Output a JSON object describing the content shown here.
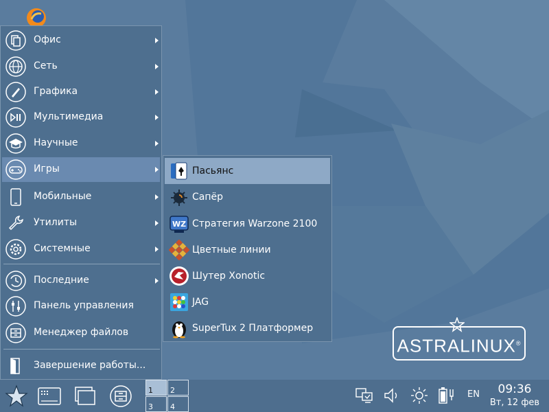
{
  "colors": {
    "desktop_bg": "#5a7c9e",
    "menu_bg": "#4e6f8f",
    "menu_highlight": "#6a8ab0",
    "submenu_highlight": "#8ea9c6",
    "taskbar_bg": "#4e6e8e",
    "text": "#ffffff"
  },
  "desktop": {
    "icon": "firefox-icon"
  },
  "main_menu": {
    "items": [
      {
        "label": "Офис",
        "icon": "office-icon",
        "submenu": true
      },
      {
        "label": "Сеть",
        "icon": "globe-icon",
        "submenu": true
      },
      {
        "label": "Графика",
        "icon": "brush-icon",
        "submenu": true
      },
      {
        "label": "Мультимедиа",
        "icon": "media-play-icon",
        "submenu": true
      },
      {
        "label": "Научные",
        "icon": "graduation-cap-icon",
        "submenu": true
      },
      {
        "label": "Игры",
        "icon": "gamepad-icon",
        "submenu": true,
        "active": true
      },
      {
        "label": "Мобильные",
        "icon": "tablet-icon",
        "submenu": true
      },
      {
        "label": "Утилиты",
        "icon": "wrench-icon",
        "submenu": true
      },
      {
        "label": "Системные",
        "icon": "gear-icon",
        "submenu": true
      },
      {
        "label": "Последние",
        "icon": "history-icon",
        "submenu": true
      },
      {
        "label": "Панель управления",
        "icon": "control-panel-icon",
        "submenu": false
      },
      {
        "label": "Менеджер файлов",
        "icon": "file-manager-icon",
        "submenu": false
      },
      {
        "label": "Завершение работы...",
        "icon": "exit-door-icon",
        "submenu": false
      }
    ]
  },
  "games_submenu": {
    "items": [
      {
        "label": "Пасьянс",
        "icon": "solitaire-cards-icon",
        "active": true
      },
      {
        "label": "Сапёр",
        "icon": "mine-icon"
      },
      {
        "label": "Стратегия Warzone 2100",
        "icon": "warzone-icon"
      },
      {
        "label": "Цветные линии",
        "icon": "color-lines-icon"
      },
      {
        "label": "Шутер Xonotic",
        "icon": "xonotic-icon"
      },
      {
        "label": "JAG",
        "icon": "jag-icon"
      },
      {
        "label": "SuperTux 2 Платформер",
        "icon": "penguin-icon"
      }
    ]
  },
  "logo": {
    "text": "ASTRALINUX",
    "mark": "®"
  },
  "taskbar": {
    "start_icon": "star-start-icon",
    "buttons": [
      "app-grid-icon",
      "windows-icon",
      "file-cabinet-icon"
    ],
    "pager": [
      "1",
      "2",
      "3",
      "4"
    ],
    "active_desktop": "1",
    "tray": [
      "network-monitor-icon",
      "volume-icon",
      "brightness-icon",
      "battery-icon"
    ],
    "language": "EN",
    "time": "09:36",
    "date": "Вт, 12 фев"
  }
}
